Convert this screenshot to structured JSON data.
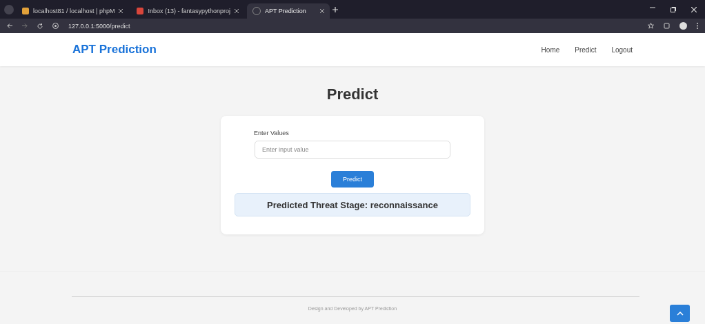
{
  "browser": {
    "tabs": [
      {
        "title": "localhost81 / localhost | phpM",
        "selected": false
      },
      {
        "title": "Inbox (13) - fantasypythonproj",
        "selected": false
      },
      {
        "title": "APT Prediction",
        "selected": true
      }
    ],
    "url": "127.0.0.1:5000/predict"
  },
  "navbar": {
    "brand": "APT Prediction",
    "links": [
      {
        "label": "Home"
      },
      {
        "label": "Predict"
      },
      {
        "label": "Logout"
      }
    ]
  },
  "page": {
    "heading": "Predict",
    "form": {
      "label": "Enter Values",
      "placeholder": "Enter input value",
      "button": "Predict"
    },
    "result": "Predicted Threat Stage: reconnaissance"
  },
  "footer": {
    "text": "Design and Developed by APT Prediction"
  }
}
